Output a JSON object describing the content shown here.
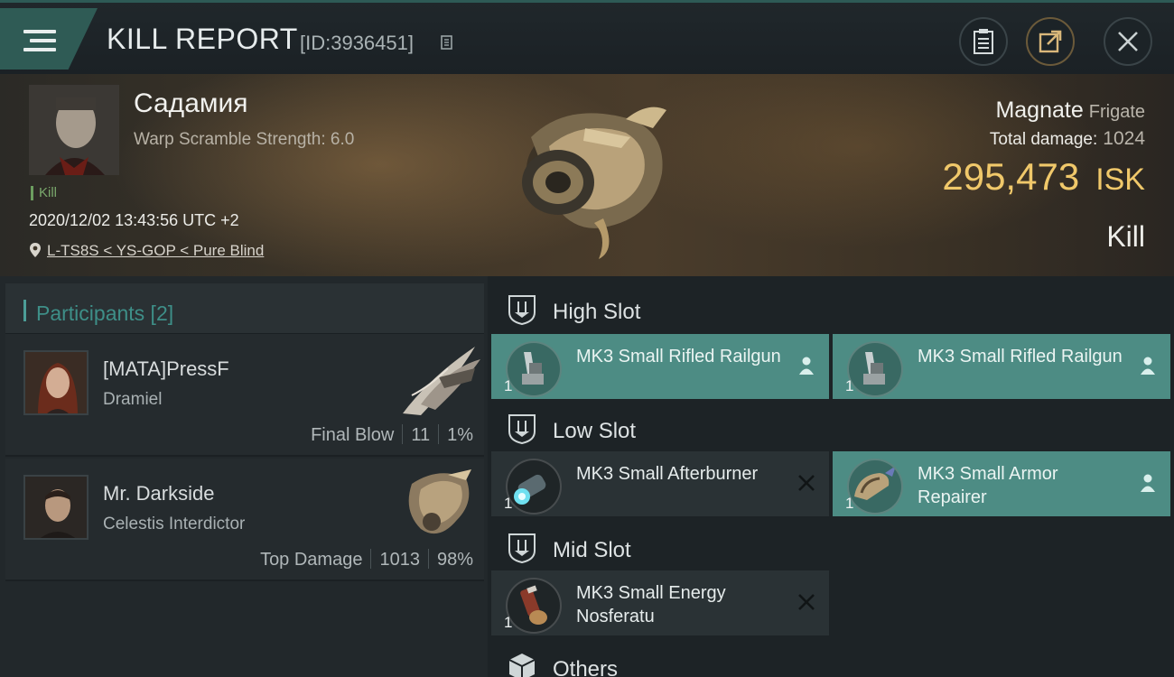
{
  "header": {
    "title": "KILL REPORT",
    "report_id": "[ID:3936451]"
  },
  "victim": {
    "name": "Садамия",
    "warp_scramble": "Warp Scramble Strength: 6.0",
    "tag": "Kill",
    "datetime": "2020/12/02 13:43:56 UTC +2",
    "location": "L-TS8S < YS-GOP < Pure Blind",
    "ship_name": "Magnate",
    "ship_class": "Frigate",
    "total_damage_label": "Total damage:",
    "total_damage": "1024",
    "isk_value": "295,473",
    "isk_unit": "ISK",
    "result": "Kill"
  },
  "participants": {
    "label": "Participants [2]",
    "list": [
      {
        "name": "[MATA]PressF",
        "ship": "Dramiel",
        "role": "Final Blow",
        "damage": "11",
        "percent": "1%"
      },
      {
        "name": "Mr. Darkside",
        "ship": "Celestis Interdictor",
        "role": "Top Damage",
        "damage": "1013",
        "percent": "98%"
      }
    ]
  },
  "slots": {
    "high": {
      "label": "High Slot",
      "items": [
        {
          "name": "MK3 Small Rifled Railgun",
          "qty": "1",
          "state": "fitted"
        },
        {
          "name": "MK3 Small Rifled Railgun",
          "qty": "1",
          "state": "fitted"
        }
      ]
    },
    "low": {
      "label": "Low Slot",
      "items": [
        {
          "name": "MK3 Small Afterburner",
          "qty": "1",
          "state": "destroyed"
        },
        {
          "name": "MK3 Small Armor Repairer",
          "qty": "1",
          "state": "fitted"
        }
      ]
    },
    "mid": {
      "label": "Mid Slot",
      "items": [
        {
          "name": "MK3 Small Energy Nosferatu",
          "qty": "1",
          "state": "destroyed"
        }
      ]
    },
    "others": {
      "label": "Others"
    }
  },
  "colors": {
    "accent": "#4d8c84",
    "isk": "#f0c86a",
    "kill_tag": "#6c9e5f"
  }
}
